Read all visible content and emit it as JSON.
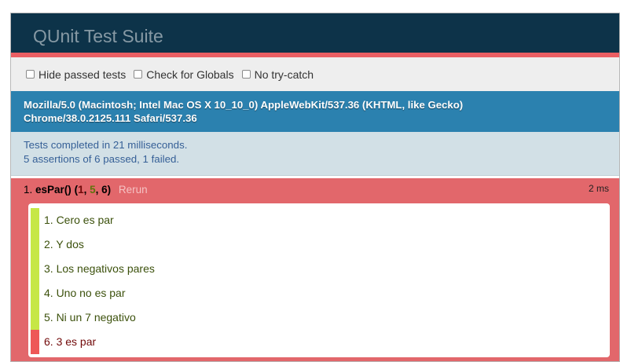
{
  "header": {
    "title": "QUnit Test Suite"
  },
  "toolbar": {
    "options": [
      {
        "label": "Hide passed tests",
        "checked": false
      },
      {
        "label": "Check for Globals",
        "checked": false
      },
      {
        "label": "No try-catch",
        "checked": false
      }
    ]
  },
  "userAgent": {
    "line1": "Mozilla/5.0 (Macintosh; Intel Mac OS X 10_10_0) AppleWebKit/537.36 (KHTML, like Gecko)",
    "line2": "Chrome/38.0.2125.111 Safari/537.36"
  },
  "banner": {
    "line1": "Tests completed in 21 milliseconds.",
    "line2": "5 assertions of 6 passed, 1 failed."
  },
  "test": {
    "index": "1.",
    "name": "esPar()",
    "open_paren": " (",
    "failed": "1",
    "sep1": ", ",
    "passed": "5",
    "sep2": ", ",
    "total": "6",
    "close_paren": ")",
    "rerun_label": "Rerun",
    "runtime": "2 ms",
    "assertions": [
      {
        "text": "1. Cero es par",
        "status": "pass"
      },
      {
        "text": "2. Y dos",
        "status": "pass"
      },
      {
        "text": "3. Los negativos pares",
        "status": "pass"
      },
      {
        "text": "4. Uno no es par",
        "status": "pass"
      },
      {
        "text": "5. Ni un 7 negativo",
        "status": "pass"
      },
      {
        "text": "6. 3 es par",
        "status": "fail"
      }
    ]
  },
  "colors": {
    "header_bg": "#0d3349",
    "fail_red": "#e2676b",
    "pass_green": "#c6e746",
    "ua_blue": "#2b81af",
    "banner_bg": "#d2e0e6"
  }
}
